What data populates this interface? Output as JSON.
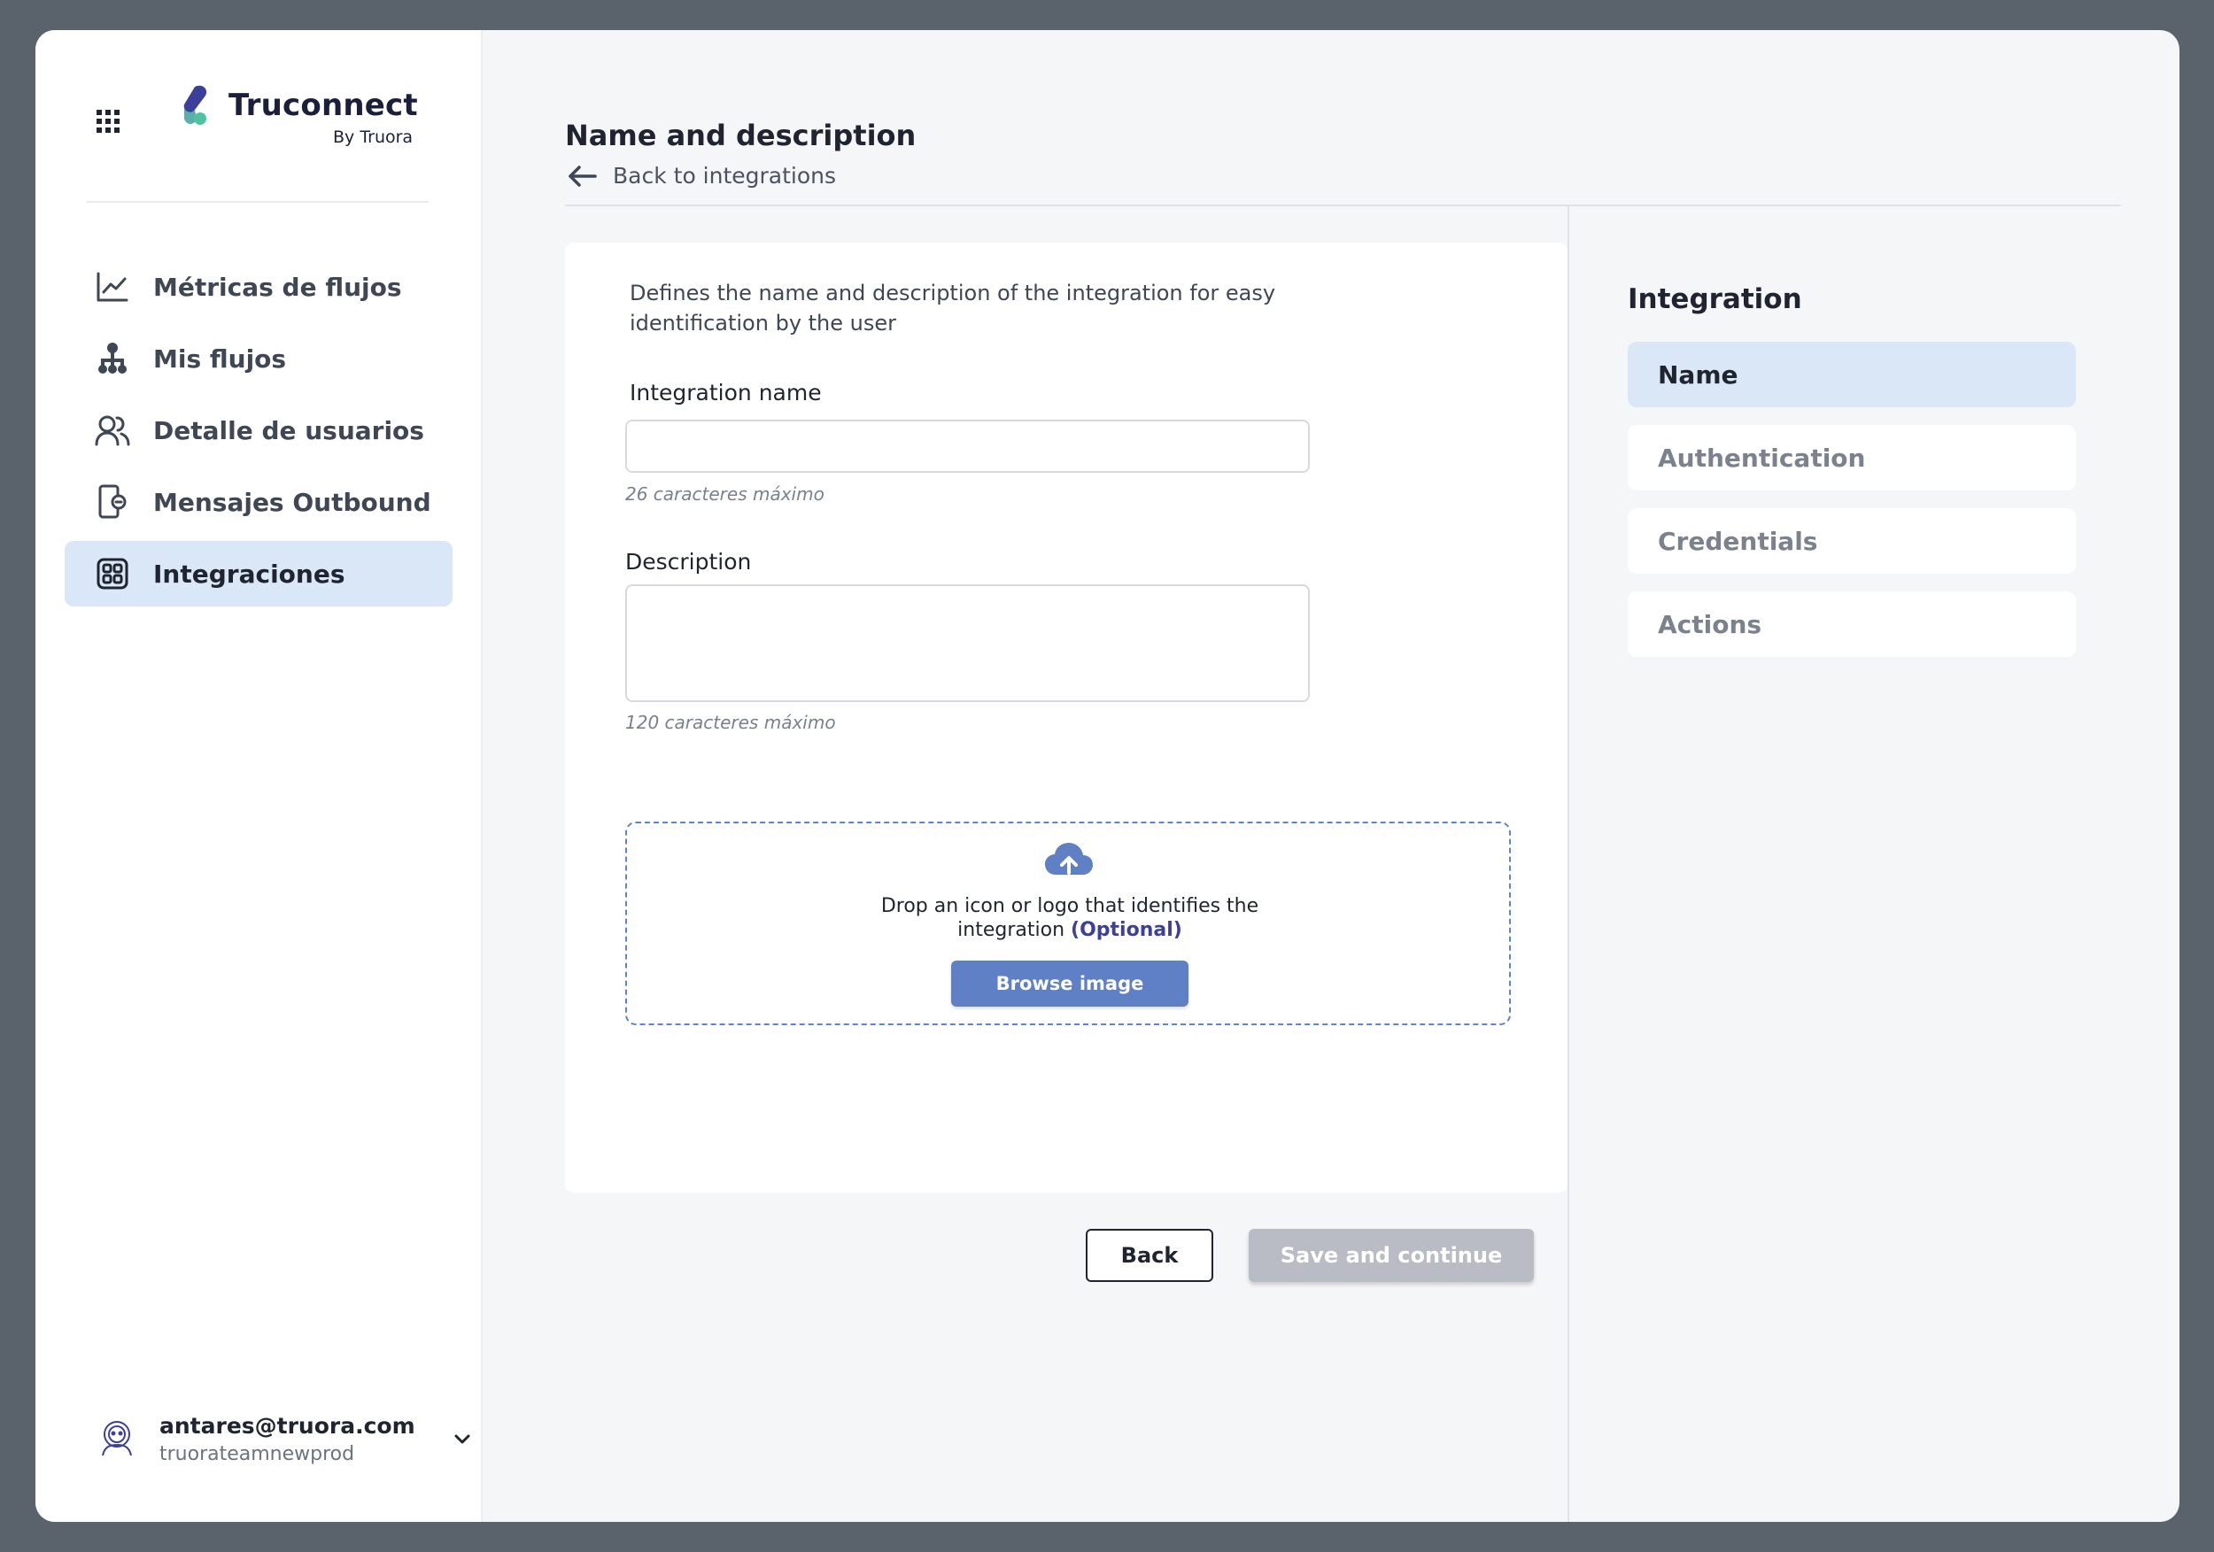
{
  "brand": {
    "name": "Truconnect",
    "sub": "By Truora"
  },
  "sidebar": {
    "items": [
      {
        "label": "Métricas de flujos",
        "icon": "chart-line-icon",
        "active": false
      },
      {
        "label": "Mis flujos",
        "icon": "flow-tree-icon",
        "active": false
      },
      {
        "label": "Detalle de usuarios",
        "icon": "users-icon",
        "active": false
      },
      {
        "label": "Mensajes Outbound",
        "icon": "phone-message-icon",
        "active": false
      },
      {
        "label": "Integraciones",
        "icon": "integrations-grid-icon",
        "active": true
      }
    ]
  },
  "user": {
    "email": "antares@truora.com",
    "team": "truorateamnewprod"
  },
  "main": {
    "title": "Name and description",
    "back_link": "Back to integrations",
    "description": "Defines the name and description of the integration for easy identification by the user",
    "name_label": "Integration name",
    "name_value": "",
    "name_hint": "26 caracteres máximo",
    "desc_label": "Description",
    "desc_value": "",
    "desc_hint": "120 caracteres máximo",
    "drop_text": "Drop an icon or logo that identifies the integration",
    "drop_optional": "(Optional)",
    "browse_label": "Browse image",
    "back_button": "Back",
    "save_button": "Save and continue"
  },
  "steps": {
    "title": "Integration",
    "items": [
      {
        "label": "Name",
        "active": true
      },
      {
        "label": "Authentication",
        "active": false
      },
      {
        "label": "Credentials",
        "active": false
      },
      {
        "label": "Actions",
        "active": false
      }
    ]
  },
  "colors": {
    "accent": "#5f80c4",
    "active_bg": "#d9e7f7",
    "optional": "#3d3f9e",
    "disabled": "#b9bcc5"
  }
}
